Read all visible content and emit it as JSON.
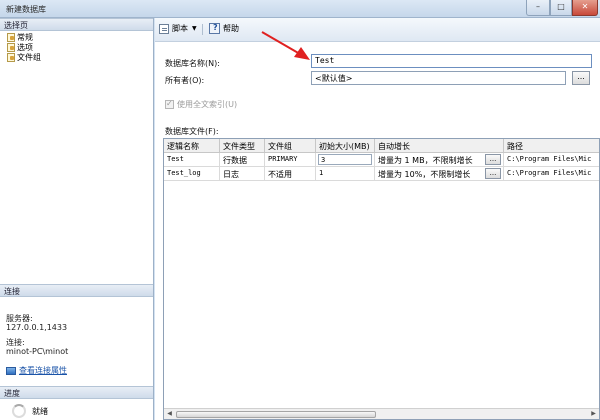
{
  "window": {
    "title": "新建数据库",
    "min": "–",
    "max": "□",
    "close": "✕"
  },
  "left": {
    "section_pages": "选择页",
    "pages": [
      "常规",
      "选项",
      "文件组"
    ],
    "section_connection": "连接",
    "server_label": "服务器:",
    "server_value": "127.0.0.1,1433",
    "conn_label": "连接:",
    "conn_value": "minot-PC\\minot",
    "view_props": "查看连接属性",
    "section_progress": "进度",
    "progress_status": "就绪"
  },
  "toolbar": {
    "script": "脚本",
    "help": "帮助",
    "dropdown": "▼"
  },
  "form": {
    "db_name_label": "数据库名称(N):",
    "db_name_value": "Test",
    "owner_label": "所有者(O):",
    "owner_value": "<默认值>",
    "browse": "...",
    "fulltext_label": "使用全文索引(U)",
    "files_label": "数据库文件(F):"
  },
  "grid": {
    "columns": [
      "逻辑名称",
      "文件类型",
      "文件组",
      "初始大小(MB)",
      "自动增长",
      "路径"
    ],
    "rows": [
      {
        "name": "Test",
        "type": "行数据",
        "group": "PRIMARY",
        "size": "3",
        "growth": "增量为 1 MB，不限制增长",
        "path": "C:\\Program Files\\Mic"
      },
      {
        "name": "Test_log",
        "type": "日志",
        "group": "不适用",
        "size": "1",
        "growth": "增量为 10%，不限制增长",
        "path": "C:\\Program Files\\Mic"
      }
    ],
    "browse": "...",
    "scroll_left": "◀",
    "scroll_right": "▶"
  },
  "colors": {
    "annotation_arrow": "#e02020",
    "link": "#1a53a8"
  }
}
